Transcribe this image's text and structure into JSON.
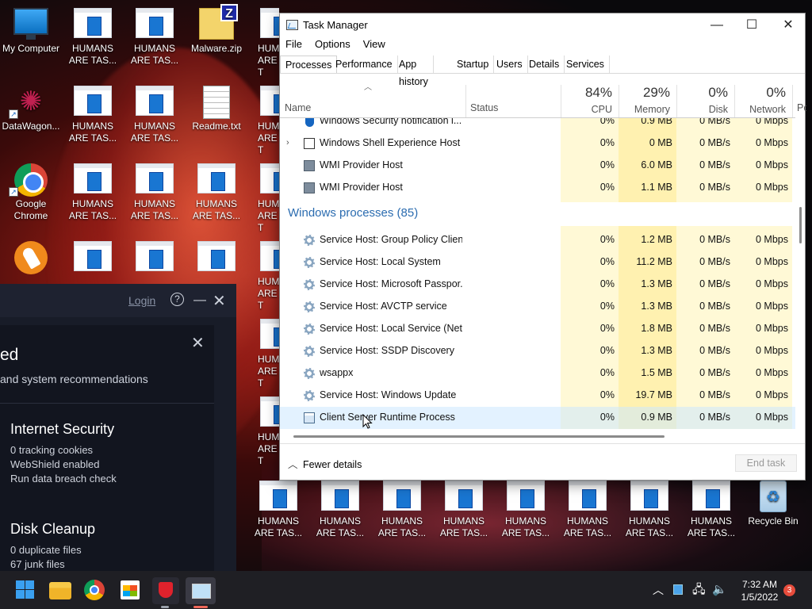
{
  "desktop": {
    "icons": {
      "my_computer": "My Computer",
      "datawagon": "DataWagon...",
      "chrome": "Google Chrome",
      "humans": "HUMANS ARE TAS...",
      "humans_cut": "HUM ARE T",
      "malware": "Malware.zip",
      "readme": "Readme.txt",
      "recycle": "Recycle Bin",
      "zip_badge": "Z"
    }
  },
  "security_app": {
    "login": "Login",
    "heading": "ed",
    "subtitle": "and system recommendations",
    "cards": [
      {
        "title": "Internet Security",
        "lines": [
          "0 tracking cookies",
          "WebShield enabled",
          "Run data breach check"
        ]
      },
      {
        "title": "Disk Cleanup",
        "lines": [
          "0 duplicate files",
          "67 junk files"
        ]
      }
    ]
  },
  "task_manager": {
    "title": "Task Manager",
    "menu": [
      "File",
      "Options",
      "View"
    ],
    "tabs": [
      "Processes",
      "Performance",
      "App history",
      "Startup",
      "Users",
      "Details",
      "Services"
    ],
    "columns": {
      "name": "Name",
      "status": "Status",
      "cpu": {
        "pct": "84%",
        "label": "CPU"
      },
      "memory": {
        "pct": "29%",
        "label": "Memory"
      },
      "disk": {
        "pct": "0%",
        "label": "Disk"
      },
      "network": {
        "pct": "0%",
        "label": "Network"
      },
      "power": "Po"
    },
    "rows_top": [
      {
        "name": "Windows Security notification i...",
        "cpu": "0%",
        "memory": "0.9 MB",
        "disk": "0 MB/s",
        "network": "0 Mbps",
        "icon": "shield-icon"
      },
      {
        "name": "Windows Shell Experience Host",
        "cpu": "0%",
        "memory": "0 MB",
        "disk": "0 MB/s",
        "network": "0 Mbps",
        "icon": "shell-icon",
        "expandable": true
      },
      {
        "name": "WMI Provider Host",
        "cpu": "0%",
        "memory": "6.0 MB",
        "disk": "0 MB/s",
        "network": "0 Mbps",
        "icon": "wmi-icon"
      },
      {
        "name": "WMI Provider Host",
        "cpu": "0%",
        "memory": "1.1 MB",
        "disk": "0 MB/s",
        "network": "0 Mbps",
        "icon": "wmi-icon"
      }
    ],
    "group": "Windows processes (85)",
    "rows_windows": [
      {
        "name": "Service Host: Group Policy Client",
        "cpu": "0%",
        "memory": "1.2 MB",
        "disk": "0 MB/s",
        "network": "0 Mbps"
      },
      {
        "name": "Service Host: Local System",
        "cpu": "0%",
        "memory": "11.2 MB",
        "disk": "0 MB/s",
        "network": "0 Mbps"
      },
      {
        "name": "Service Host: Microsoft Passpor...",
        "cpu": "0%",
        "memory": "1.3 MB",
        "disk": "0 MB/s",
        "network": "0 Mbps"
      },
      {
        "name": "Service Host: AVCTP service",
        "cpu": "0%",
        "memory": "1.3 MB",
        "disk": "0 MB/s",
        "network": "0 Mbps"
      },
      {
        "name": "Service Host: Local Service (Net...",
        "cpu": "0%",
        "memory": "1.8 MB",
        "disk": "0 MB/s",
        "network": "0 Mbps"
      },
      {
        "name": "Service Host: SSDP Discovery",
        "cpu": "0%",
        "memory": "1.3 MB",
        "disk": "0 MB/s",
        "network": "0 Mbps"
      },
      {
        "name": "wsappx",
        "cpu": "0%",
        "memory": "1.5 MB",
        "disk": "0 MB/s",
        "network": "0 Mbps"
      },
      {
        "name": "Service Host: Windows Update",
        "cpu": "0%",
        "memory": "19.7 MB",
        "disk": "0 MB/s",
        "network": "0 Mbps"
      },
      {
        "name": "Client Server Runtime Process",
        "cpu": "0%",
        "memory": "0.9 MB",
        "disk": "0 MB/s",
        "network": "0 Mbps",
        "selected": true,
        "icon": "csrss-icon"
      }
    ],
    "fewer_details": "Fewer details",
    "end_task": "End task",
    "colors": {
      "heat_light": "#fff9d6",
      "heat_mid": "#fff1b0",
      "group_blue": "#2b6cb0"
    }
  },
  "taskbar": {
    "time": "7:32 AM",
    "date": "1/5/2022",
    "notifications": "3"
  }
}
